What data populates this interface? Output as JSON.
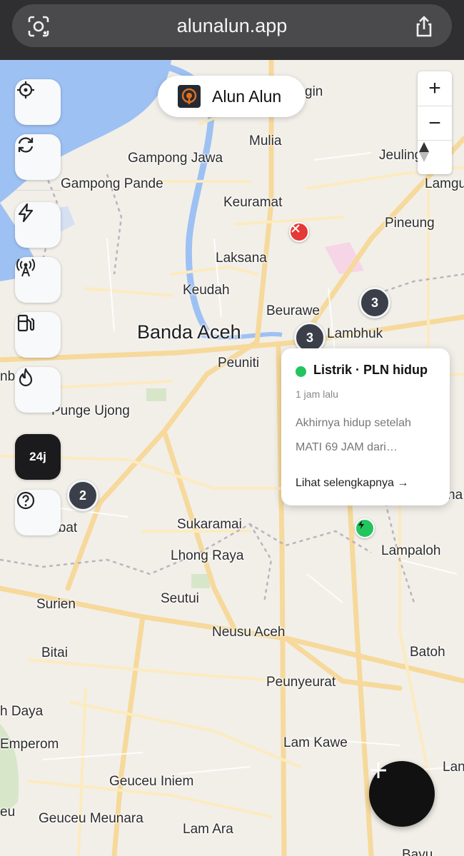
{
  "browser": {
    "url": "alunalun.app",
    "left_icon": "screenshot-lens-icon",
    "right_icon": "share-icon"
  },
  "app": {
    "brand_name": "Alun Alun",
    "brand_icon": "alun-alun-logo"
  },
  "controls": {
    "locate": "crosshair-icon",
    "refresh": "refresh-icon",
    "filters": [
      "lightning-icon",
      "signal-tower-icon",
      "fuel-pump-icon",
      "flame-icon"
    ],
    "time_filter_label": "24j",
    "help": "question-icon"
  },
  "zoom": {
    "in_label": "+",
    "out_label": "−",
    "compass": "compass-icon"
  },
  "places": [
    "gin",
    "Mulia",
    "Gampong Jawa",
    "Jeuling",
    "Gampong Pande",
    "Lamgu",
    "Keuramat",
    "Pineung",
    "Laksana",
    "Keudah",
    "Beurawe",
    "Banda Aceh",
    "Lambhuk",
    "Peuniti",
    "nbung",
    "Punge Ujong",
    "na",
    "Lamjabat",
    "Sukaramai",
    "Lampaloh",
    "Lhong Raya",
    "Seutui",
    "Surien",
    "Neusu Aceh",
    "Bitai",
    "Batoh",
    "Peunyeurat",
    "h Daya",
    "Emperom",
    "Lam Kawe",
    "Lan",
    "Geuceu Iniem",
    "eu",
    "Geuceu Meunara",
    "Lam Ara",
    "Bayu"
  ],
  "clusters": [
    "3",
    "3",
    "2"
  ],
  "markers": {
    "restaurant_pin": "fork-knife-icon",
    "electricity_pin": "lightning-icon",
    "restaurant_color": "#e53935",
    "electricity_color": "#22c55e"
  },
  "popup": {
    "status_color": "#22c55e",
    "title": "Listrik · PLN hidup",
    "time": "1 jam lalu",
    "body": "Akhirnya hidup setelah MATI 69 JAM dari…",
    "link": "Lihat selengkapnya →"
  },
  "fab": {
    "label": "+",
    "icon": "plus-icon"
  }
}
